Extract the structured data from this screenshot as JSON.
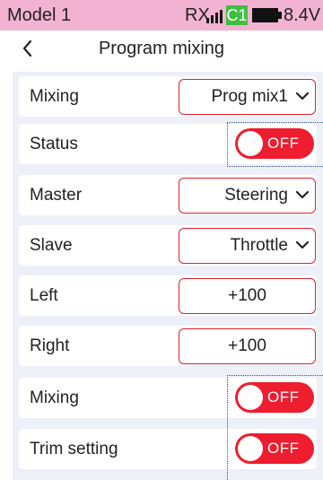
{
  "status_bar": {
    "model": "Model 1",
    "rx_label": "RX",
    "channel": "C1",
    "voltage": "8.4V",
    "colors": {
      "background": "#f2b3d2",
      "channel_badge": "#3fbf3f"
    }
  },
  "header": {
    "title": "Program mixing",
    "back_icon": "chevron-left-icon"
  },
  "rows": {
    "mixing_select": {
      "label": "Mixing",
      "value": "Prog mix1"
    },
    "status": {
      "label": "Status",
      "toggle": "OFF"
    },
    "master": {
      "label": "Master",
      "value": "Steering"
    },
    "slave": {
      "label": "Slave",
      "value": "Throttle"
    },
    "left": {
      "label": "Left",
      "value": "+100"
    },
    "right": {
      "label": "Right",
      "value": "+100"
    },
    "mixing_toggle": {
      "label": "Mixing",
      "toggle": "OFF"
    },
    "trim_setting": {
      "label": "Trim setting",
      "toggle": "OFF"
    }
  },
  "colors": {
    "accent": "#e0202e",
    "toggle_off": "#ee1d2f",
    "panel": "#eef0f8",
    "highlight_border": "#2a4d9b"
  }
}
